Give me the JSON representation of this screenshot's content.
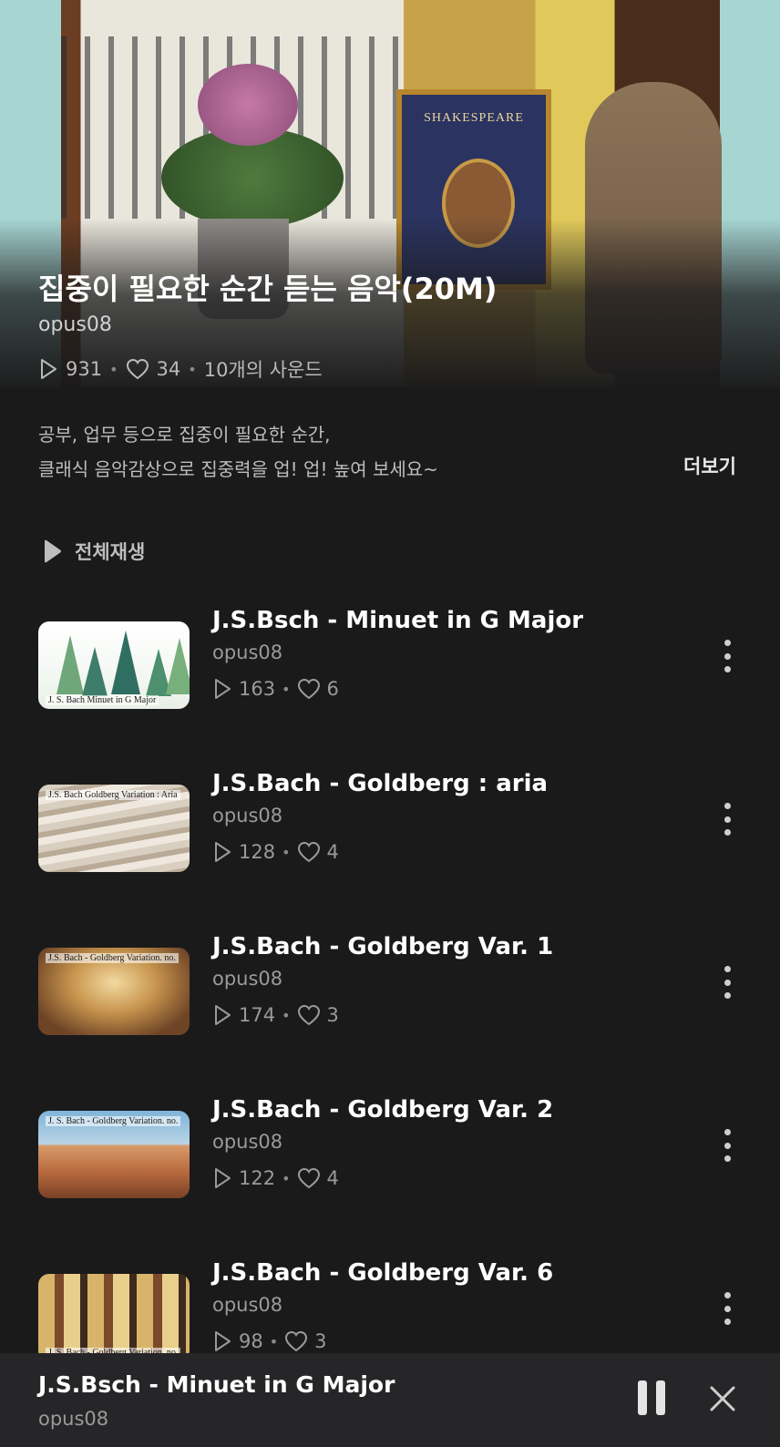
{
  "playlist": {
    "title": "집중이 필요한 순간 듣는 음악(20M)",
    "author": "opus08",
    "plays": "931",
    "likes": "34",
    "sound_count": "10개의 사운드",
    "description_line1": "공부, 업무 등으로 집중이 필요한 순간,",
    "description_line2": "클래식 음악감상으로 집중력을 업! 업! 높여 보세요~",
    "more_label": "더보기",
    "play_all_label": "전체재생",
    "cover_book_text": "SHAKESPEARE"
  },
  "tracks": [
    {
      "name": "J.S.Bsch - Minuet in G Major",
      "author": "opus08",
      "plays": "163",
      "likes": "6",
      "thumb_caption": "J. S. Bach   Minuet  in G Major"
    },
    {
      "name": "J.S.Bach - Goldberg : aria",
      "author": "opus08",
      "plays": "128",
      "likes": "4",
      "thumb_caption": "J.S. Bach   Goldberg Variation : Aria"
    },
    {
      "name": "J.S.Bach - Goldberg Var. 1",
      "author": "opus08",
      "plays": "174",
      "likes": "3",
      "thumb_caption": "J.S. Bach - Goldberg Variation. no."
    },
    {
      "name": "J.S.Bach - Goldberg Var. 2",
      "author": "opus08",
      "plays": "122",
      "likes": "4",
      "thumb_caption": "J. S. Bach - Goldberg Variation. no."
    },
    {
      "name": "J.S.Bach - Goldberg Var. 6",
      "author": "opus08",
      "plays": "98",
      "likes": "3",
      "thumb_caption": "J. S. Bach - Goldberg Variation. no."
    }
  ],
  "now_playing": {
    "title": "J.S.Bsch - Minuet in G Major",
    "author": "opus08"
  },
  "colors": {
    "background": "#1a1a1b",
    "player_bar": "#262628",
    "hero_sky": "#a6d5d2"
  }
}
